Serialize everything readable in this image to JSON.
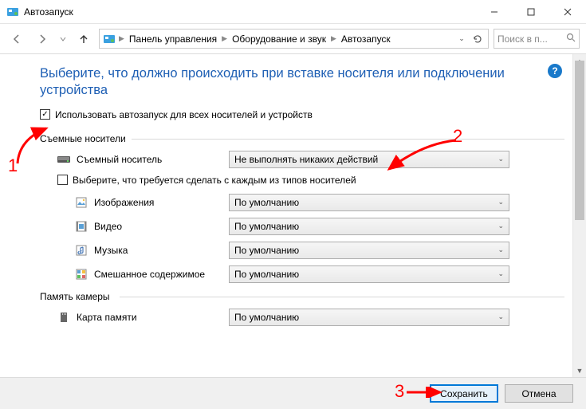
{
  "window": {
    "title": "Автозапуск"
  },
  "nav": {
    "crumbs": [
      "Панель управления",
      "Оборудование и звук",
      "Автозапуск"
    ],
    "search_placeholder": "Поиск в п..."
  },
  "help_icon": "?",
  "page_title": "Выберите, что должно происходить при вставке носителя или подключении устройства",
  "checkbox_all": {
    "checked": true,
    "label": "Использовать автозапуск для всех носителей и устройств"
  },
  "section_removable": {
    "legend": "Съемные носители",
    "main": {
      "label": "Съемный носитель",
      "value": "Не выполнять никаких действий"
    },
    "sub_checkbox": {
      "checked": false,
      "label": "Выберите, что требуется сделать с каждым из типов носителей"
    },
    "items": [
      {
        "icon": "image-icon",
        "label": "Изображения",
        "value": "По умолчанию"
      },
      {
        "icon": "video-icon",
        "label": "Видео",
        "value": "По умолчанию"
      },
      {
        "icon": "music-icon",
        "label": "Музыка",
        "value": "По умолчанию"
      },
      {
        "icon": "mixed-icon",
        "label": "Смешанное содержимое",
        "value": "По умолчанию"
      }
    ]
  },
  "section_camera": {
    "legend": "Память камеры",
    "item": {
      "icon": "sdcard-icon",
      "label": "Карта памяти",
      "value": "По умолчанию"
    }
  },
  "footer": {
    "save": "Сохранить",
    "cancel": "Отмена"
  },
  "annotations": {
    "n1": "1",
    "n2": "2",
    "n3": "3"
  }
}
